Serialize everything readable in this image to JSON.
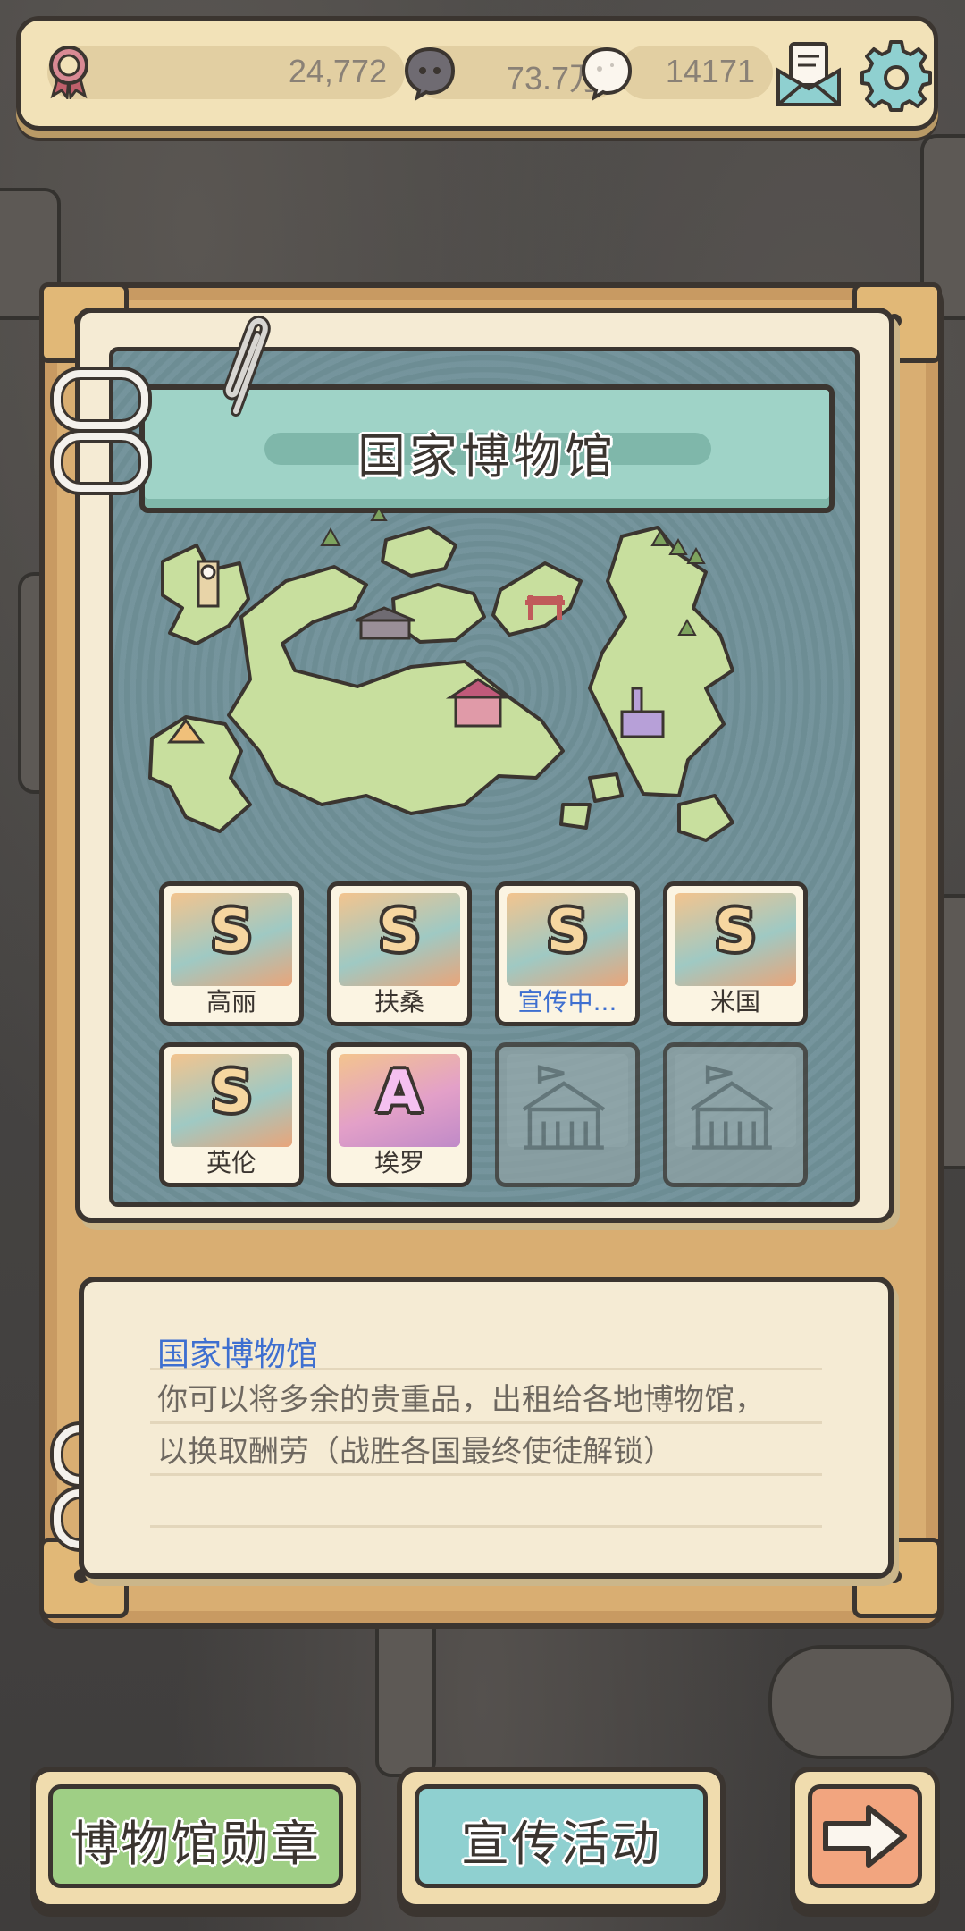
{
  "topbar": {
    "medals": "24,772",
    "coins": "73.7万",
    "gems": "14171",
    "icons": [
      "medal-icon",
      "dark-bubble-icon",
      "white-bubble-icon",
      "mail-icon",
      "gear-icon"
    ]
  },
  "panel": {
    "title": "国家博物馆"
  },
  "museums": [
    {
      "grade": "S",
      "label": "高丽",
      "state": "active"
    },
    {
      "grade": "S",
      "label": "扶桑",
      "state": "active"
    },
    {
      "grade": "S",
      "label": "宣传中...",
      "state": "promoting"
    },
    {
      "grade": "S",
      "label": "米国",
      "state": "active"
    },
    {
      "grade": "S",
      "label": "英伦",
      "state": "active"
    },
    {
      "grade": "A",
      "label": "埃罗",
      "state": "active"
    },
    {
      "grade": "",
      "label": "",
      "state": "locked"
    },
    {
      "grade": "",
      "label": "",
      "state": "locked"
    }
  ],
  "description": {
    "title": "国家博物馆",
    "line1": "你可以将多余的贵重品，出租给各地博物馆，",
    "line2": "以换取酬劳（战胜各国最终使徒解锁）"
  },
  "buttons": {
    "medal": "博物馆勋章",
    "promo": "宣传活动"
  },
  "colors": {
    "accent_blue": "#3e6fd0",
    "banner_teal": "#9fd3c7",
    "button_green": "#9fcf85",
    "button_teal": "#8fd0d0",
    "button_orange": "#f2a57f"
  }
}
